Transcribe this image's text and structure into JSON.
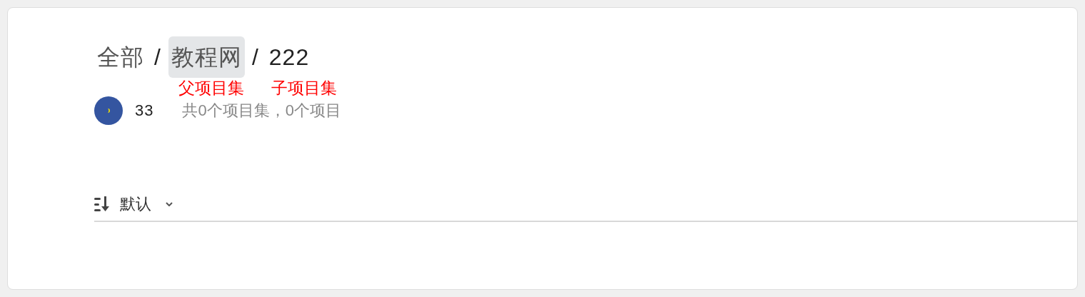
{
  "breadcrumb": [
    {
      "label": "全部",
      "highlighted": false,
      "current": false
    },
    {
      "label": "教程网",
      "highlighted": true,
      "current": false
    },
    {
      "label": "222",
      "highlighted": false,
      "current": true
    }
  ],
  "separator": "/",
  "annotations": [
    "父项目集",
    "子项目集"
  ],
  "owner": {
    "name": "33"
  },
  "summary": "共0个项目集，0个项目",
  "sort": {
    "label": "默认"
  }
}
